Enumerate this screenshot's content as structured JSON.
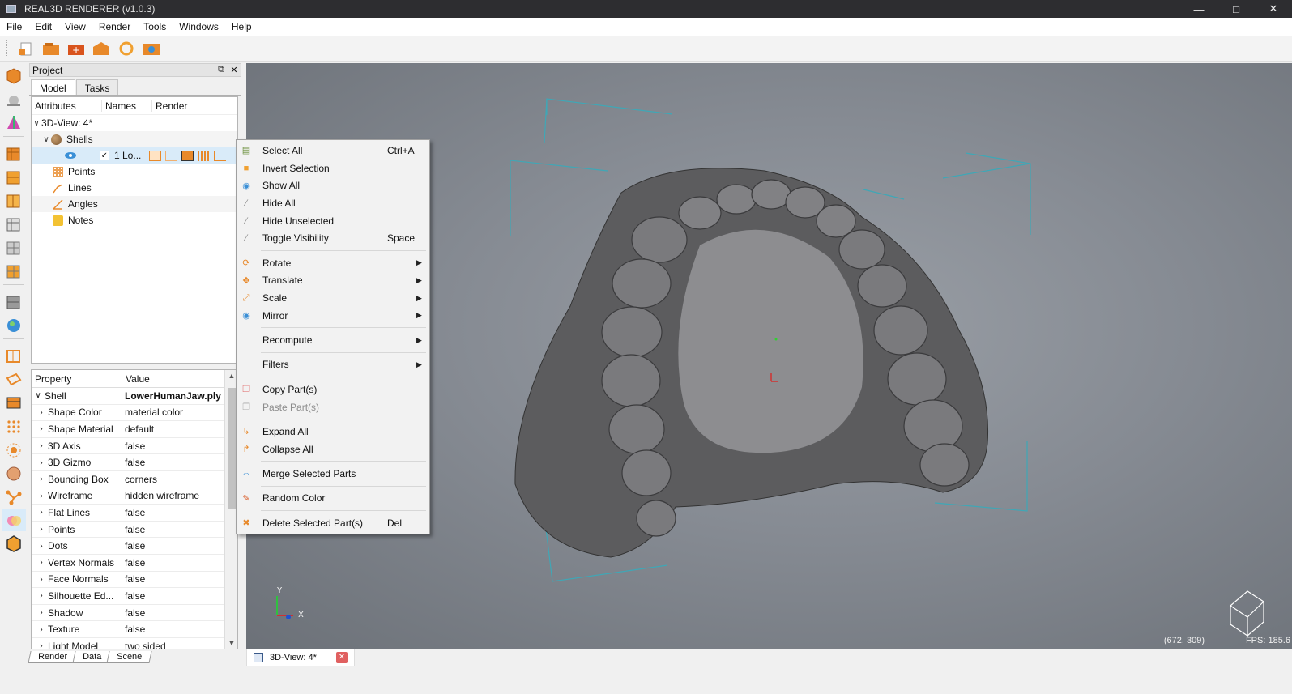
{
  "window": {
    "title": "REAL3D RENDERER (v1.0.3)",
    "controls": [
      "minimize-icon",
      "maximize-icon",
      "close-icon"
    ]
  },
  "menubar": [
    "File",
    "Edit",
    "View",
    "Render",
    "Tools",
    "Windows",
    "Help"
  ],
  "toolbar": [
    "new-project-icon",
    "open-icon",
    "add-model-icon",
    "import-icon",
    "refresh-icon",
    "screenshot-icon"
  ],
  "lefttools": [
    "box-shape-icon",
    "paint-drop-icon",
    "axis-gizmo-icon",
    "solid-cube-icon",
    "cube-faces-icon",
    "cube-edges-icon",
    "cube-wire-icon",
    "cube-grid-icon",
    "cube-mesh-icon",
    "cube-outline-icon",
    "globe-texture-icon",
    "bbox-corners-icon",
    "plane-icon",
    "layers-icon",
    "dots-icon",
    "burst-icon",
    "sphere-icon",
    "graph-icon",
    "gradient-icon",
    "hexagon-icon"
  ],
  "project": {
    "title": "Project",
    "tabs": [
      "Model",
      "Tasks"
    ],
    "tree": {
      "columns": [
        "Attributes",
        "Names",
        "Render"
      ],
      "root": "3D-View: 4*",
      "shells": "Shells",
      "item": "1 Lo...",
      "points": "Points",
      "lines": "Lines",
      "angles": "Angles",
      "notes": "Notes"
    },
    "properties": {
      "columns": [
        "Property",
        "Value"
      ],
      "group": {
        "name": "Shell",
        "value": "LowerHumanJaw.ply"
      },
      "rows": [
        {
          "name": "Shape Color",
          "value": "material color"
        },
        {
          "name": "Shape Material",
          "value": "default"
        },
        {
          "name": "3D Axis",
          "value": "false"
        },
        {
          "name": "3D Gizmo",
          "value": "false"
        },
        {
          "name": "Bounding Box",
          "value": "corners"
        },
        {
          "name": "Wireframe",
          "value": "hidden wireframe"
        },
        {
          "name": "Flat Lines",
          "value": "false"
        },
        {
          "name": "Points",
          "value": "false"
        },
        {
          "name": "Dots",
          "value": "false"
        },
        {
          "name": "Vertex Normals",
          "value": "false"
        },
        {
          "name": "Face Normals",
          "value": "false"
        },
        {
          "name": "Silhouette Ed...",
          "value": "false"
        },
        {
          "name": "Shadow",
          "value": "false"
        },
        {
          "name": "Texture",
          "value": "false"
        },
        {
          "name": "Light Model",
          "value": "two sided"
        }
      ]
    },
    "bottom_tabs": [
      "Render",
      "Data",
      "Scene"
    ]
  },
  "context_menu": {
    "items": [
      {
        "label": "Select All",
        "shortcut": "Ctrl+A",
        "icon": "select-all-icon"
      },
      {
        "label": "Invert Selection",
        "shortcut": "",
        "icon": "invert-selection-icon"
      },
      {
        "label": "Show All",
        "shortcut": "",
        "icon": "eye-icon"
      },
      {
        "label": "Hide All",
        "shortcut": "",
        "icon": "hide-icon"
      },
      {
        "label": "Hide Unselected",
        "shortcut": "",
        "icon": "hide-unselected-icon"
      },
      {
        "label": "Toggle Visibility",
        "shortcut": "Space",
        "icon": "toggle-visibility-icon"
      },
      {
        "sep": true
      },
      {
        "label": "Rotate",
        "submenu": true,
        "icon": "rotate-3d-icon"
      },
      {
        "label": "Translate",
        "submenu": true,
        "icon": "translate-icon"
      },
      {
        "label": "Scale",
        "submenu": true,
        "icon": "scale-icon"
      },
      {
        "label": "Mirror",
        "submenu": true,
        "icon": "mirror-icon"
      },
      {
        "sep": true
      },
      {
        "label": "Recompute",
        "submenu": true,
        "icon": ""
      },
      {
        "sep": true
      },
      {
        "label": "Filters",
        "submenu": true,
        "icon": ""
      },
      {
        "sep": true
      },
      {
        "label": "Copy Part(s)",
        "shortcut": "",
        "icon": "copy-icon"
      },
      {
        "label": "Paste Part(s)",
        "shortcut": "",
        "icon": "paste-icon",
        "disabled": true
      },
      {
        "sep": true
      },
      {
        "label": "Expand All",
        "shortcut": "",
        "icon": "expand-icon"
      },
      {
        "label": "Collapse All",
        "shortcut": "",
        "icon": "collapse-icon"
      },
      {
        "sep": true
      },
      {
        "label": "Merge Selected Parts",
        "shortcut": "",
        "icon": "merge-icon"
      },
      {
        "sep": true
      },
      {
        "label": "Random Color",
        "shortcut": "",
        "icon": "random-color-icon"
      },
      {
        "sep": true
      },
      {
        "label": "Delete Selected Part(s)",
        "shortcut": "Del",
        "icon": "delete-icon"
      }
    ]
  },
  "viewport": {
    "coords": "(672, 309)",
    "fps": "FPS: 185.6",
    "axis_y": "Y",
    "axis_x": "X"
  },
  "view_tab": {
    "label": "3D-View: 4*"
  },
  "colors": {
    "accent_orange": "#e8892a",
    "selection_blue": "#d9ebf9",
    "titlebar": "#2d2d30",
    "viewport_bg": "#868b93",
    "bbox_lines": "#3fa7b6"
  }
}
